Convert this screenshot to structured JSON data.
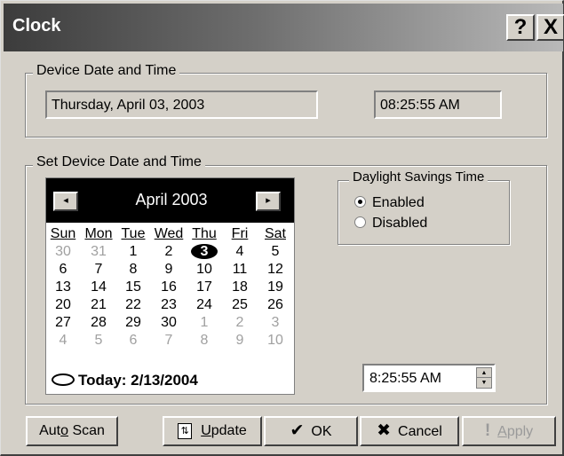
{
  "window": {
    "title": "Clock",
    "help_label": "?",
    "close_label": "X"
  },
  "device_group": {
    "label": "Device Date and Time",
    "date_value": "Thursday, April 03, 2003",
    "time_value": "08:25:55 AM"
  },
  "set_group": {
    "label": "Set Device Date and Time"
  },
  "calendar": {
    "month_label": "April 2003",
    "prev_label": "◂",
    "next_label": "▸",
    "weekdays": [
      "Sun",
      "Mon",
      "Tue",
      "Wed",
      "Thu",
      "Fri",
      "Sat"
    ],
    "weeks": [
      [
        "30",
        "31",
        "1",
        "2",
        "3",
        "4",
        "5"
      ],
      [
        "6",
        "7",
        "8",
        "9",
        "10",
        "11",
        "12"
      ],
      [
        "13",
        "14",
        "15",
        "16",
        "17",
        "18",
        "19"
      ],
      [
        "20",
        "21",
        "22",
        "23",
        "24",
        "25",
        "26"
      ],
      [
        "27",
        "28",
        "29",
        "30",
        "1",
        "2",
        "3"
      ],
      [
        "4",
        "5",
        "6",
        "7",
        "8",
        "9",
        "10"
      ]
    ],
    "selected_day": "3",
    "today_label": "Today: 2/13/2004"
  },
  "dst": {
    "label": "Daylight Savings Time",
    "enabled_label": "Enabled",
    "disabled_label": "Disabled",
    "selected": "Enabled"
  },
  "time_picker": {
    "value": "8:25:55 AM"
  },
  "buttons": {
    "auto_scan_pre": "Aut",
    "auto_scan_key": "o",
    "auto_scan_post": " Scan",
    "update_key": "U",
    "update_post": "pdate",
    "ok_label": "OK",
    "cancel_label": "Cancel",
    "apply_key": "A",
    "apply_post": "pply"
  },
  "icons": {
    "ok": "checkmark-icon",
    "cancel": "x-icon",
    "apply": "exclamation-icon",
    "update": "update-icon"
  }
}
